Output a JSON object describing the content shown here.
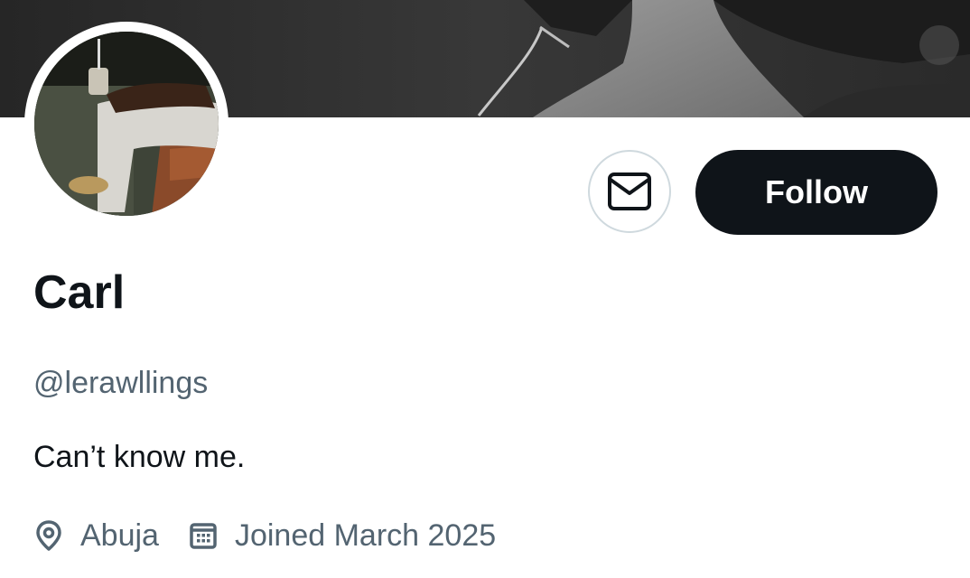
{
  "profile": {
    "display_name": "Carl",
    "handle": "@lerawllings",
    "bio": "Can’t know me.",
    "location": "Abuja",
    "joined": "Joined March 2025"
  },
  "actions": {
    "follow_label": "Follow",
    "message_icon": "envelope-icon"
  },
  "icons": {
    "location": "location-pin-icon",
    "joined": "calendar-icon"
  },
  "colors": {
    "primary_text": "#0f1419",
    "secondary_text": "#536471",
    "button_dark": "#0f1419",
    "border": "#cfd9de"
  }
}
